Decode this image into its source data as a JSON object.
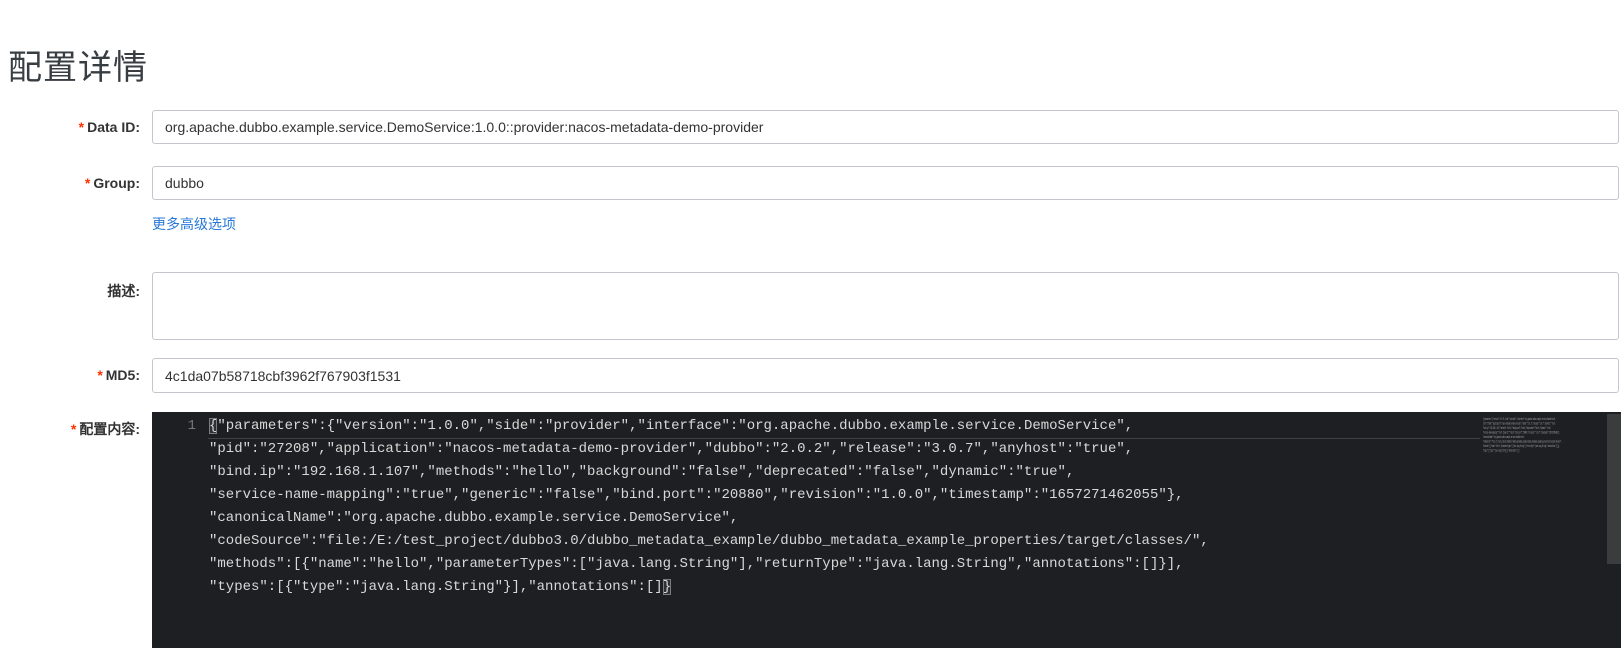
{
  "page": {
    "title": "配置详情"
  },
  "form": {
    "required_marker": "*",
    "data_id": {
      "label": "Data ID:",
      "required": true,
      "value": "org.apache.dubbo.example.service.DemoService:1.0.0::provider:nacos-metadata-demo-provider"
    },
    "group": {
      "label": "Group:",
      "required": true,
      "value": "dubbo"
    },
    "more_options_link": "更多高级选项",
    "description": {
      "label": "描述:",
      "required": false,
      "value": ""
    },
    "md5": {
      "label": "MD5:",
      "required": true,
      "value": "4c1da07b58718cbf3962f767903f1531"
    },
    "content": {
      "label": "配置内容:",
      "required": true
    }
  },
  "editor": {
    "line_number": "1",
    "wrapped_rows": [
      "{\"parameters\":{\"version\":\"1.0.0\",\"side\":\"provider\",\"interface\":\"org.apache.dubbo.example.service.DemoService\",",
      "\"pid\":\"27208\",\"application\":\"nacos-metadata-demo-provider\",\"dubbo\":\"2.0.2\",\"release\":\"3.0.7\",\"anyhost\":\"true\",",
      "\"bind.ip\":\"192.168.1.107\",\"methods\":\"hello\",\"background\":\"false\",\"deprecated\":\"false\",\"dynamic\":\"true\",",
      "\"service-name-mapping\":\"true\",\"generic\":\"false\",\"bind.port\":\"20880\",\"revision\":\"1.0.0\",\"timestamp\":\"1657271462055\"},",
      "\"canonicalName\":\"org.apache.dubbo.example.service.DemoService\",",
      "\"codeSource\":\"file:/E:/test_project/dubbo3.0/dubbo_metadata_example/dubbo_metadata_example_properties/target/classes/\",",
      "\"methods\":[{\"name\":\"hello\",\"parameterTypes\":[\"java.lang.String\"],\"returnType\":\"java.lang.String\",\"annotations\":[]}],",
      "\"types\":[{\"type\":\"java.lang.String\"}],\"annotations\":[]}"
    ]
  },
  "colors": {
    "link": "#2878d8",
    "required_asterisk": "#ff3000",
    "editor_background": "#1e1f22",
    "editor_text": "#d8d8d8",
    "input_border": "#c4c6cf"
  }
}
